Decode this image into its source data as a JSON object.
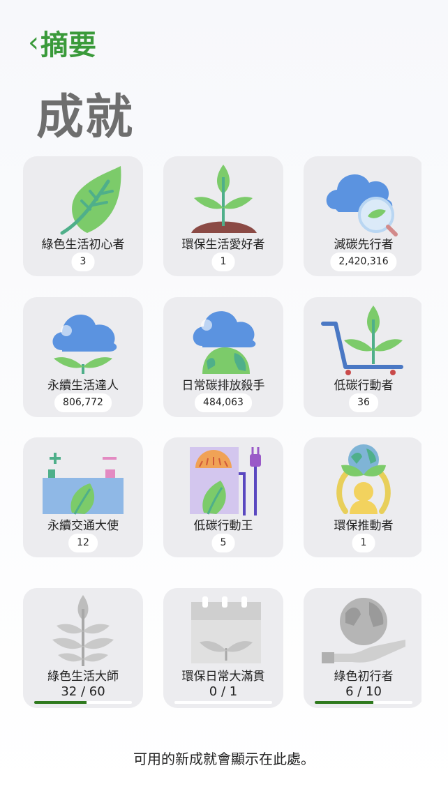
{
  "header": {
    "back_label": "摘要",
    "title": "成就"
  },
  "achievements": [
    {
      "name": "綠色生活初心者",
      "count": "3",
      "icon": "leaf-icon"
    },
    {
      "name": "環保生活愛好者",
      "count": "1",
      "icon": "sprout-icon"
    },
    {
      "name": "減碳先行者",
      "count": "2,420,316",
      "icon": "cloud-magnifier-icon"
    },
    {
      "name": "永續生活達人",
      "count": "806,772",
      "icon": "cloud-sprout-icon"
    },
    {
      "name": "日常碳排放殺手",
      "count": "484,063",
      "icon": "cloud-earth-icon"
    },
    {
      "name": "低碳行動者",
      "count": "36",
      "icon": "cart-sprout-icon"
    },
    {
      "name": "永續交通大使",
      "count": "12",
      "icon": "battery-leaf-icon"
    },
    {
      "name": "低碳行動王",
      "count": "5",
      "icon": "charger-leaf-icon"
    },
    {
      "name": "環保推動者",
      "count": "1",
      "icon": "person-earth-icon"
    }
  ],
  "locked": [
    {
      "name": "綠色生活大師",
      "progress_text": "32 / 60",
      "progress": 0.533,
      "icon": "plant-icon"
    },
    {
      "name": "環保日常大滿貫",
      "progress_text": "0 / 1",
      "progress": 0.0,
      "icon": "calendar-sprout-icon"
    },
    {
      "name": "綠色初行者",
      "progress_text": "6 / 10",
      "progress": 0.6,
      "icon": "hand-earth-icon"
    }
  ],
  "footer": {
    "note": "可用的新成就會顯示在此處。"
  },
  "colors": {
    "accent": "#3a9a3a",
    "progress": "#2f7a1e",
    "card": "#ececef"
  }
}
